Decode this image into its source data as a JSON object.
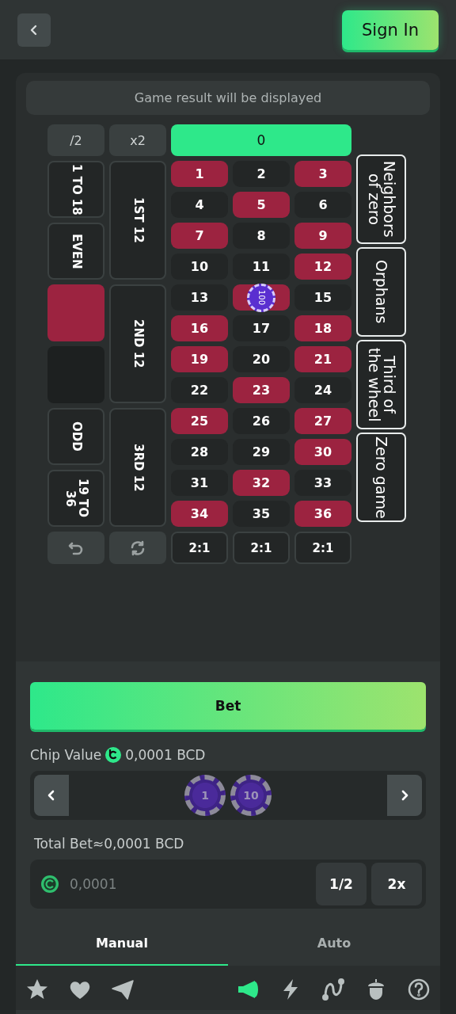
{
  "header": {
    "sign_in": "Sign In"
  },
  "result_banner": "Game result will be displayed",
  "board": {
    "top": [
      "/2",
      "x2"
    ],
    "zero": "0",
    "outside": [
      {
        "kind": "text",
        "label": "1 TO 18"
      },
      {
        "kind": "text",
        "label": "EVEN"
      },
      {
        "kind": "red"
      },
      {
        "kind": "black"
      },
      {
        "kind": "text",
        "label": "ODD"
      },
      {
        "kind": "text",
        "label": "19 TO 36"
      }
    ],
    "dozens": [
      "1ST 12",
      "2ND 12",
      "3RD 12"
    ],
    "numbers": [
      {
        "label": "1",
        "color": "#9c2340"
      },
      {
        "label": "2",
        "color": "#232626"
      },
      {
        "label": "3",
        "color": "#9c2340"
      },
      {
        "label": "4",
        "color": "#232626"
      },
      {
        "label": "5",
        "color": "#9c2340"
      },
      {
        "label": "6",
        "color": "#232626"
      },
      {
        "label": "7",
        "color": "#9c2340"
      },
      {
        "label": "8",
        "color": "#232626"
      },
      {
        "label": "9",
        "color": "#9c2340"
      },
      {
        "label": "10",
        "color": "#232626"
      },
      {
        "label": "11",
        "color": "#232626"
      },
      {
        "label": "12",
        "color": "#9c2340"
      },
      {
        "label": "13",
        "color": "#232626"
      },
      {
        "color": "#9c2340",
        "chip": "100"
      },
      {
        "label": "15",
        "color": "#232626"
      },
      {
        "label": "16",
        "color": "#9c2340"
      },
      {
        "label": "17",
        "color": "#232626"
      },
      {
        "label": "18",
        "color": "#9c2340"
      },
      {
        "label": "19",
        "color": "#9c2340"
      },
      {
        "label": "20",
        "color": "#232626"
      },
      {
        "label": "21",
        "color": "#9c2340"
      },
      {
        "label": "22",
        "color": "#232626"
      },
      {
        "label": "23",
        "color": "#9c2340"
      },
      {
        "label": "24",
        "color": "#232626"
      },
      {
        "label": "25",
        "color": "#9c2340"
      },
      {
        "label": "26",
        "color": "#232626"
      },
      {
        "label": "27",
        "color": "#9c2340"
      },
      {
        "label": "28",
        "color": "#232626"
      },
      {
        "label": "29",
        "color": "#232626"
      },
      {
        "label": "30",
        "color": "#9c2340"
      },
      {
        "label": "31",
        "color": "#232626"
      },
      {
        "label": "32",
        "color": "#9c2340"
      },
      {
        "label": "33",
        "color": "#232626"
      },
      {
        "label": "34",
        "color": "#9c2340"
      },
      {
        "label": "35",
        "color": "#232626"
      },
      {
        "label": "36",
        "color": "#9c2340"
      }
    ],
    "columns": [
      "2:1",
      "2:1",
      "2:1"
    ],
    "races": [
      "Neighbors of zero",
      "Orphans",
      "Third of the wheel",
      "Zero game"
    ]
  },
  "bet_button": "Bet",
  "chip_value": {
    "label": "Chip Value",
    "amount": "0,0001 BCD"
  },
  "chips": [
    {
      "value": "1"
    },
    {
      "value": "10"
    }
  ],
  "total_bet": "Total Bet≈0,0001 BCD",
  "amount_input": {
    "placeholder": "0,0001"
  },
  "amount_buttons": [
    "1/2",
    "2x"
  ],
  "tabs": [
    {
      "label": "Manual",
      "selected": true
    },
    {
      "label": "Auto",
      "selected": false
    }
  ],
  "toolbar_left": [
    {
      "kind": "star",
      "on": false
    },
    {
      "kind": "heart",
      "on": false
    },
    {
      "kind": "send",
      "on": false
    }
  ],
  "toolbar_right": [
    {
      "kind": "speaker",
      "on": true
    },
    {
      "kind": "lightning",
      "on": false
    },
    {
      "kind": "curve",
      "on": false
    },
    {
      "kind": "acorn",
      "on": false
    },
    {
      "kind": "help",
      "on": false
    }
  ]
}
